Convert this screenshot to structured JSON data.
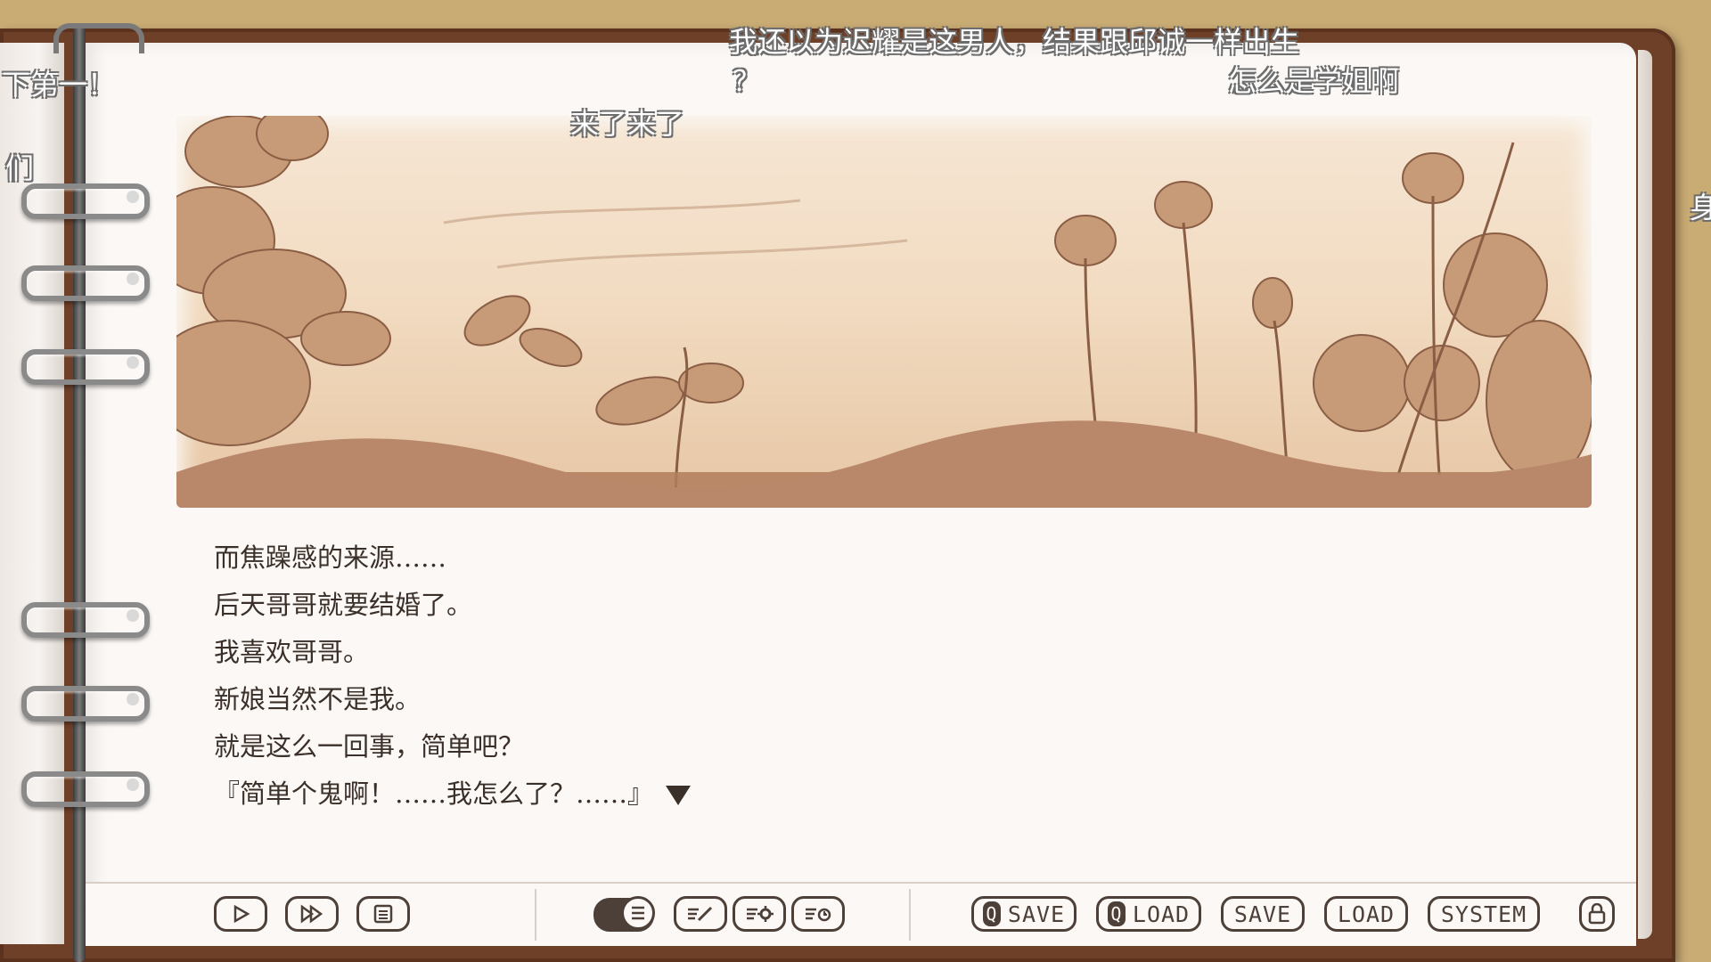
{
  "comments": [
    {
      "id": "c1",
      "text": "我还以为迟耀是这男人，结果跟邱诚一样出生"
    },
    {
      "id": "c2",
      "text": "？"
    },
    {
      "id": "c3",
      "text": "怎么是学姐啊"
    },
    {
      "id": "c4",
      "text": "来了来了"
    },
    {
      "id": "c5",
      "text": "下第一！"
    },
    {
      "id": "c6",
      "text": "们"
    },
    {
      "id": "c7",
      "text": "身"
    }
  ],
  "narration": {
    "lines": [
      "而焦躁感的来源……",
      "后天哥哥就要结婚了。",
      "我喜欢哥哥。",
      "新娘当然不是我。",
      "就是这么一回事，简单吧？",
      "『简单个鬼啊！……我怎么了？……』"
    ],
    "continue_icon": "triangle-down-icon"
  },
  "toolbar": {
    "playback": [
      {
        "name": "auto-play-button",
        "icon": "play-icon"
      },
      {
        "name": "skip-button",
        "icon": "fast-forward-icon"
      },
      {
        "name": "backlog-button",
        "icon": "list-icon"
      }
    ],
    "window_toggle_icon": "text-window-toggle-icon",
    "settings": [
      {
        "name": "text-settings-button",
        "icon": "pen-lines-icon"
      },
      {
        "name": "config-button",
        "icon": "gear-lines-icon"
      },
      {
        "name": "voice-settings-button",
        "icon": "clock-lines-icon"
      }
    ],
    "qsave_label": "SAVE",
    "qload_label": "LOAD",
    "q_badge": "Q",
    "save_label": "SAVE",
    "load_label": "LOAD",
    "system_label": "SYSTEM",
    "lock_icon": "lock-icon"
  },
  "colors": {
    "binder": "#6d4027",
    "page": "#fbf8f5",
    "ink": "#3b3029",
    "sepia": "#b07e5c"
  }
}
